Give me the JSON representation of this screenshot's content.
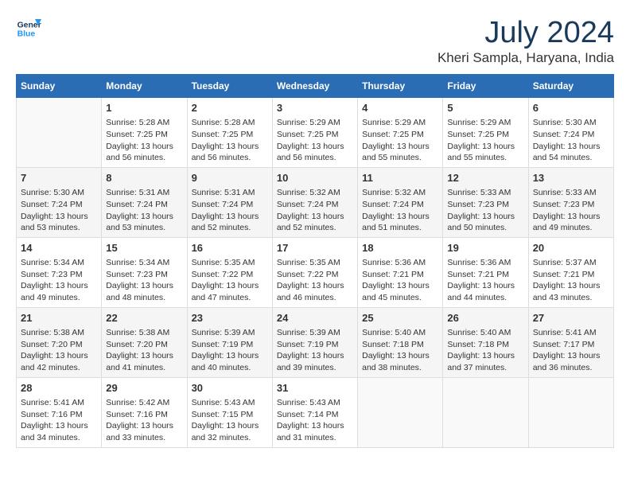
{
  "header": {
    "logo_line1": "General",
    "logo_line2": "Blue",
    "title": "July 2024",
    "subtitle": "Kheri Sampla, Haryana, India"
  },
  "days_of_week": [
    "Sunday",
    "Monday",
    "Tuesday",
    "Wednesday",
    "Thursday",
    "Friday",
    "Saturday"
  ],
  "weeks": [
    [
      {
        "day": "",
        "info": ""
      },
      {
        "day": "1",
        "info": "Sunrise: 5:28 AM\nSunset: 7:25 PM\nDaylight: 13 hours\nand 56 minutes."
      },
      {
        "day": "2",
        "info": "Sunrise: 5:28 AM\nSunset: 7:25 PM\nDaylight: 13 hours\nand 56 minutes."
      },
      {
        "day": "3",
        "info": "Sunrise: 5:29 AM\nSunset: 7:25 PM\nDaylight: 13 hours\nand 56 minutes."
      },
      {
        "day": "4",
        "info": "Sunrise: 5:29 AM\nSunset: 7:25 PM\nDaylight: 13 hours\nand 55 minutes."
      },
      {
        "day": "5",
        "info": "Sunrise: 5:29 AM\nSunset: 7:25 PM\nDaylight: 13 hours\nand 55 minutes."
      },
      {
        "day": "6",
        "info": "Sunrise: 5:30 AM\nSunset: 7:24 PM\nDaylight: 13 hours\nand 54 minutes."
      }
    ],
    [
      {
        "day": "7",
        "info": "Sunrise: 5:30 AM\nSunset: 7:24 PM\nDaylight: 13 hours\nand 53 minutes."
      },
      {
        "day": "8",
        "info": "Sunrise: 5:31 AM\nSunset: 7:24 PM\nDaylight: 13 hours\nand 53 minutes."
      },
      {
        "day": "9",
        "info": "Sunrise: 5:31 AM\nSunset: 7:24 PM\nDaylight: 13 hours\nand 52 minutes."
      },
      {
        "day": "10",
        "info": "Sunrise: 5:32 AM\nSunset: 7:24 PM\nDaylight: 13 hours\nand 52 minutes."
      },
      {
        "day": "11",
        "info": "Sunrise: 5:32 AM\nSunset: 7:24 PM\nDaylight: 13 hours\nand 51 minutes."
      },
      {
        "day": "12",
        "info": "Sunrise: 5:33 AM\nSunset: 7:23 PM\nDaylight: 13 hours\nand 50 minutes."
      },
      {
        "day": "13",
        "info": "Sunrise: 5:33 AM\nSunset: 7:23 PM\nDaylight: 13 hours\nand 49 minutes."
      }
    ],
    [
      {
        "day": "14",
        "info": "Sunrise: 5:34 AM\nSunset: 7:23 PM\nDaylight: 13 hours\nand 49 minutes."
      },
      {
        "day": "15",
        "info": "Sunrise: 5:34 AM\nSunset: 7:23 PM\nDaylight: 13 hours\nand 48 minutes."
      },
      {
        "day": "16",
        "info": "Sunrise: 5:35 AM\nSunset: 7:22 PM\nDaylight: 13 hours\nand 47 minutes."
      },
      {
        "day": "17",
        "info": "Sunrise: 5:35 AM\nSunset: 7:22 PM\nDaylight: 13 hours\nand 46 minutes."
      },
      {
        "day": "18",
        "info": "Sunrise: 5:36 AM\nSunset: 7:21 PM\nDaylight: 13 hours\nand 45 minutes."
      },
      {
        "day": "19",
        "info": "Sunrise: 5:36 AM\nSunset: 7:21 PM\nDaylight: 13 hours\nand 44 minutes."
      },
      {
        "day": "20",
        "info": "Sunrise: 5:37 AM\nSunset: 7:21 PM\nDaylight: 13 hours\nand 43 minutes."
      }
    ],
    [
      {
        "day": "21",
        "info": "Sunrise: 5:38 AM\nSunset: 7:20 PM\nDaylight: 13 hours\nand 42 minutes."
      },
      {
        "day": "22",
        "info": "Sunrise: 5:38 AM\nSunset: 7:20 PM\nDaylight: 13 hours\nand 41 minutes."
      },
      {
        "day": "23",
        "info": "Sunrise: 5:39 AM\nSunset: 7:19 PM\nDaylight: 13 hours\nand 40 minutes."
      },
      {
        "day": "24",
        "info": "Sunrise: 5:39 AM\nSunset: 7:19 PM\nDaylight: 13 hours\nand 39 minutes."
      },
      {
        "day": "25",
        "info": "Sunrise: 5:40 AM\nSunset: 7:18 PM\nDaylight: 13 hours\nand 38 minutes."
      },
      {
        "day": "26",
        "info": "Sunrise: 5:40 AM\nSunset: 7:18 PM\nDaylight: 13 hours\nand 37 minutes."
      },
      {
        "day": "27",
        "info": "Sunrise: 5:41 AM\nSunset: 7:17 PM\nDaylight: 13 hours\nand 36 minutes."
      }
    ],
    [
      {
        "day": "28",
        "info": "Sunrise: 5:41 AM\nSunset: 7:16 PM\nDaylight: 13 hours\nand 34 minutes."
      },
      {
        "day": "29",
        "info": "Sunrise: 5:42 AM\nSunset: 7:16 PM\nDaylight: 13 hours\nand 33 minutes."
      },
      {
        "day": "30",
        "info": "Sunrise: 5:43 AM\nSunset: 7:15 PM\nDaylight: 13 hours\nand 32 minutes."
      },
      {
        "day": "31",
        "info": "Sunrise: 5:43 AM\nSunset: 7:14 PM\nDaylight: 13 hours\nand 31 minutes."
      },
      {
        "day": "",
        "info": ""
      },
      {
        "day": "",
        "info": ""
      },
      {
        "day": "",
        "info": ""
      }
    ]
  ]
}
